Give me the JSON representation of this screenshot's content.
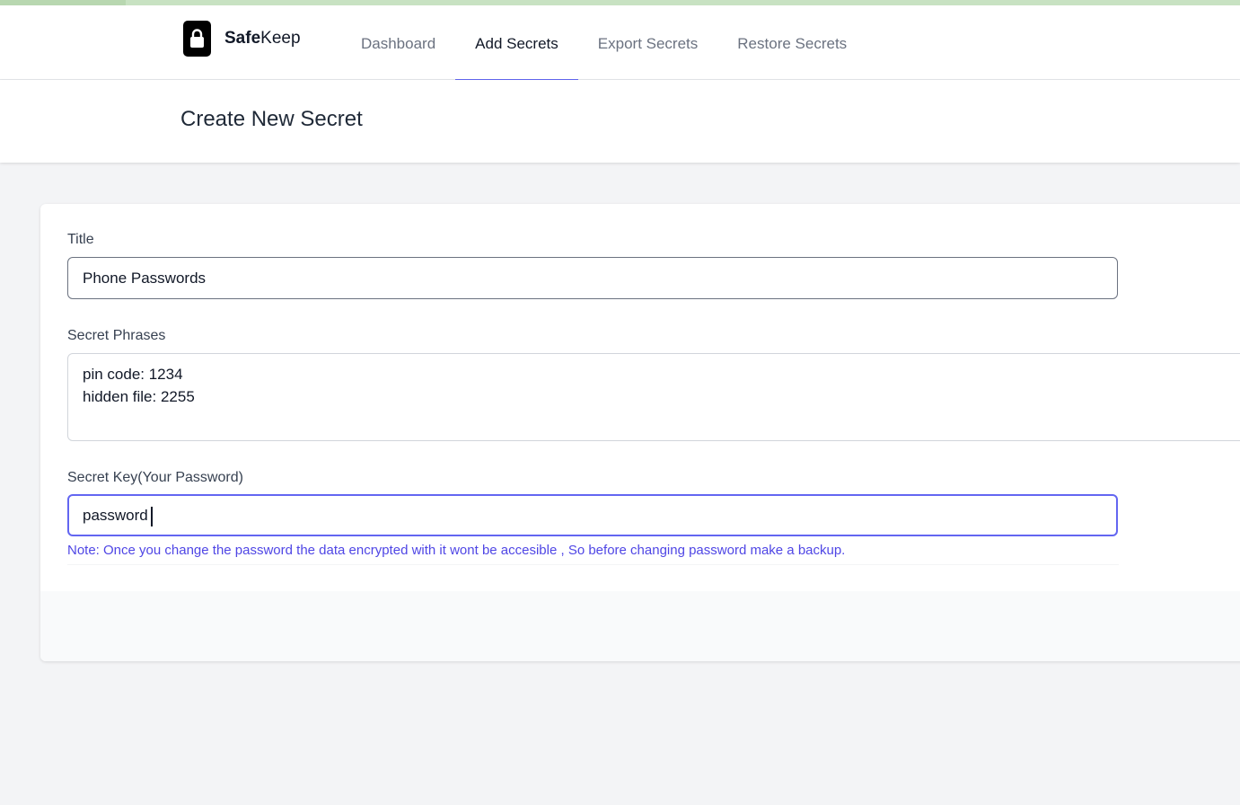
{
  "app": {
    "brand_bold": "Safe",
    "brand_rest": "Keep"
  },
  "nav": {
    "tabs": [
      {
        "label": "Dashboard",
        "active": false
      },
      {
        "label": "Add Secrets",
        "active": true
      },
      {
        "label": "Export Secrets",
        "active": false
      },
      {
        "label": "Restore Secrets",
        "active": false
      }
    ]
  },
  "page": {
    "title": "Create New Secret"
  },
  "form": {
    "title_label": "Title",
    "title_value": "Phone Passwords",
    "phrases_label": "Secret Phrases",
    "phrases_value": "pin code: 1234\nhidden file: 2255",
    "key_label": "Secret Key(Your Password)",
    "key_value": "password",
    "note": "Note: Once you change the password the data encrypted with it wont be accesible , So before changing password make a backup."
  },
  "colors": {
    "accent": "#6366f1",
    "note_text": "#4f46e5",
    "background": "#f3f4f6",
    "top_strip": "#c8e2c2"
  },
  "icons": {
    "logo": "lock-icon"
  }
}
